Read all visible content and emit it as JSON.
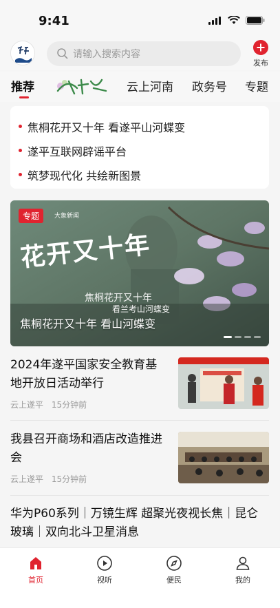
{
  "status": {
    "time": "9:41"
  },
  "header": {
    "logo_text": "遂平",
    "search_placeholder": "请输入搜索内容",
    "publish_label": "发布"
  },
  "tabs": [
    {
      "label": "推荐",
      "active": true
    },
    {
      "label": "花开又十年",
      "is_logo": true
    },
    {
      "label": "云上河南"
    },
    {
      "label": "政务号"
    },
    {
      "label": "专题"
    }
  ],
  "headlines": [
    "焦桐花开又十年 看遂平山河蝶变",
    "遂平互联网辟谣平台",
    "筑梦现代化 共绘新图景"
  ],
  "banner": {
    "tag": "专题",
    "media": "大象新闻",
    "art_title": "花开又十年",
    "sub1": "焦桐花开又十年",
    "sub2": "看兰考山河蝶变",
    "caption": "焦桐花开又十年 看山河蝶变"
  },
  "news": [
    {
      "title": "2024年遂平国家安全教育基地开放日活动举行",
      "source": "云上遂平",
      "time": "15分钟前"
    },
    {
      "title": "我县召开商场和酒店改造推进会",
      "source": "云上遂平",
      "time": "15分钟前"
    },
    {
      "title": "华为P60系列｜万镜生辉 超聚光夜视长焦｜昆仑玻璃｜双向北斗卫星消息"
    }
  ],
  "bottom_nav": [
    {
      "label": "首页",
      "icon": "home-icon",
      "active": true
    },
    {
      "label": "视听",
      "icon": "play-circle-icon"
    },
    {
      "label": "便民",
      "icon": "compass-icon"
    },
    {
      "label": "我的",
      "icon": "user-icon"
    }
  ],
  "colors": {
    "accent": "#e0232f",
    "background": "#f5f5f5"
  }
}
